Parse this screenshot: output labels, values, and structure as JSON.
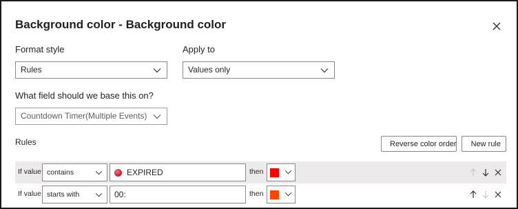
{
  "dialog": {
    "title": "Background color - Background color",
    "close_icon": "close-icon"
  },
  "format_style": {
    "label": "Format style",
    "value": "Rules"
  },
  "apply_to": {
    "label": "Apply to",
    "value": "Values only"
  },
  "base_field": {
    "label": "What field should we base this on?",
    "value": "Countdown Timer(Multiple Events)"
  },
  "rules_section": {
    "label": "Rules",
    "reverse_button": "Reverse color order",
    "reverse_icon": "sort-arrows-icon",
    "new_rule_button": "New rule",
    "new_rule_icon": "plus-icon"
  },
  "rules": [
    {
      "if_label": "If value",
      "operator": "contains",
      "value": "EXPIRED",
      "value_icon": "red-circle-icon",
      "then_label": "then",
      "color": "#ff0000",
      "shaded": true,
      "move_up_enabled": false,
      "move_down_enabled": true
    },
    {
      "if_label": "If value",
      "operator": "starts with",
      "value": "00:",
      "then_label": "then",
      "color": "#ff4500",
      "shaded": false,
      "move_up_enabled": true,
      "move_down_enabled": false
    }
  ],
  "colors": {
    "border": "#8a8886",
    "disabled_icon": "#c8c6c4",
    "row_shade": "#eceaea"
  }
}
